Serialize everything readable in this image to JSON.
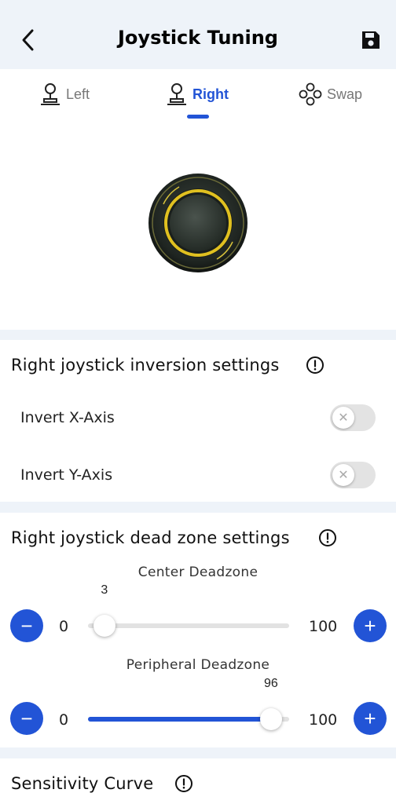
{
  "header": {
    "title": "Joystick Tuning"
  },
  "tabs": [
    {
      "label": "Left",
      "active": false
    },
    {
      "label": "Right",
      "active": true
    },
    {
      "label": "Swap",
      "active": false
    }
  ],
  "inversion": {
    "title": "Right joystick inversion settings",
    "rows": [
      {
        "label": "Invert X-Axis",
        "on": false
      },
      {
        "label": "Invert Y-Axis",
        "on": false
      }
    ]
  },
  "deadzone": {
    "title": "Right joystick dead zone settings",
    "center": {
      "label": "Center Deadzone",
      "min": "0",
      "max": "100",
      "value": 3
    },
    "peripheral": {
      "label": "Peripheral Deadzone",
      "min": "0",
      "max": "100",
      "value": 96
    }
  },
  "curve": {
    "title": "Sensitivity Curve"
  },
  "colors": {
    "accent": "#2254d6",
    "page_bg": "#eef3f9",
    "ring": "#e0c020"
  },
  "icons": {
    "back": "chevron-left-icon",
    "save": "floppy-disk-icon",
    "info": "info-circle-icon",
    "minus": "minus-icon",
    "plus": "plus-icon"
  }
}
